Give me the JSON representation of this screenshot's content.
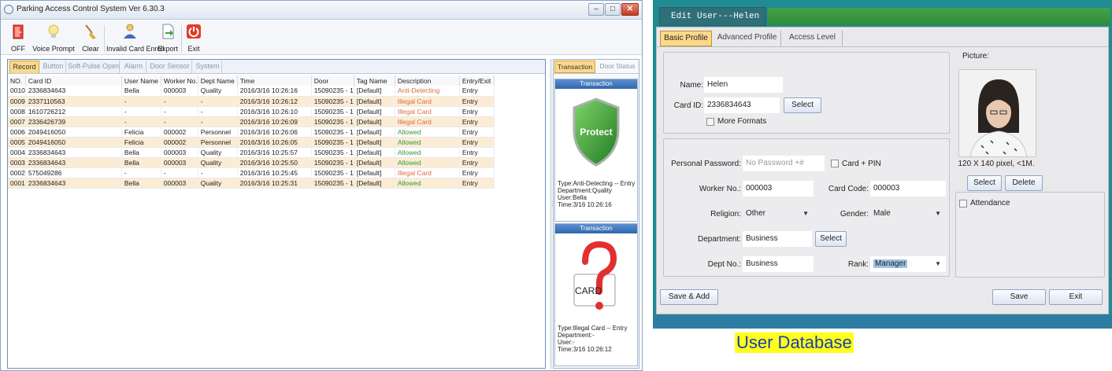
{
  "left_window": {
    "title": "Parking Access Control System  Ver 6.30.3",
    "controls": [
      "–",
      "□",
      "✕"
    ],
    "toolbar": [
      {
        "label": "OFF",
        "icon": "door-icon"
      },
      {
        "label": "Voice Prompt",
        "icon": "lightbulb-icon"
      },
      {
        "label": "Clear",
        "icon": "broom-icon"
      },
      {
        "label": "Invalid Card Enroll",
        "icon": "person-icon"
      },
      {
        "label": "Export",
        "icon": "export-icon"
      },
      {
        "label": "Exit",
        "icon": "power-icon"
      }
    ],
    "tabs": [
      "Record",
      "Button",
      "Soft-Pulse Open",
      "Alarm",
      "Door Sensor",
      "System"
    ],
    "active_tab": "Record",
    "table": {
      "columns": [
        "NO.",
        "Card ID",
        "User Name",
        "Worker No.",
        "Dept Name",
        "Time",
        "Door",
        "Tag Name",
        "Description",
        "Entry/Exit"
      ],
      "rows": [
        {
          "no": "0010",
          "card": "2336834643",
          "user": "Bella",
          "worker": "000003",
          "dept": "Quality",
          "time": "2016/3/16 10:26:16",
          "door": "15090235 - 1",
          "tag": "[Default]",
          "desc": "Anti-Detecting",
          "status": "red",
          "entry": "Entry"
        },
        {
          "no": "0009",
          "card": "2337110563",
          "user": "-",
          "worker": "-",
          "dept": "-",
          "time": "2016/3/16 10:26:12",
          "door": "15090235 - 1",
          "tag": "[Default]",
          "desc": "Illegal Card",
          "status": "red",
          "entry": "Entry"
        },
        {
          "no": "0008",
          "card": "1610726212",
          "user": "-",
          "worker": "-",
          "dept": "-",
          "time": "2016/3/16 10:26:10",
          "door": "15090235 - 1",
          "tag": "[Default]",
          "desc": "Illegal Card",
          "status": "red",
          "entry": "Entry"
        },
        {
          "no": "0007",
          "card": "2336426739",
          "user": "-",
          "worker": "-",
          "dept": "-",
          "time": "2016/3/16 10:26:09",
          "door": "15090235 - 1",
          "tag": "[Default]",
          "desc": "Illegal Card",
          "status": "red",
          "entry": "Entry"
        },
        {
          "no": "0006",
          "card": "2049416050",
          "user": "Felicia",
          "worker": "000002",
          "dept": "Personnel",
          "time": "2016/3/16 10:26:06",
          "door": "15090235 - 1",
          "tag": "[Default]",
          "desc": "Allowed",
          "status": "green",
          "entry": "Entry"
        },
        {
          "no": "0005",
          "card": "2049416050",
          "user": "Felicia",
          "worker": "000002",
          "dept": "Personnel",
          "time": "2016/3/16 10:26:05",
          "door": "15090235 - 1",
          "tag": "[Default]",
          "desc": "Allowed",
          "status": "green",
          "entry": "Entry"
        },
        {
          "no": "0004",
          "card": "2336834643",
          "user": "Bella",
          "worker": "000003",
          "dept": "Quality",
          "time": "2016/3/16 10:25:57",
          "door": "15090235 - 1",
          "tag": "[Default]",
          "desc": "Allowed",
          "status": "green",
          "entry": "Entry"
        },
        {
          "no": "0003",
          "card": "2336834643",
          "user": "Bella",
          "worker": "000003",
          "dept": "Quality",
          "time": "2016/3/16 10:25:50",
          "door": "15090235 - 1",
          "tag": "[Default]",
          "desc": "Allowed",
          "status": "green",
          "entry": "Entry"
        },
        {
          "no": "0002",
          "card": "575049286",
          "user": "-",
          "worker": "-",
          "dept": "-",
          "time": "2016/3/16 10:25:45",
          "door": "15090235 - 1",
          "tag": "[Default]",
          "desc": "Illegal Card",
          "status": "red",
          "entry": "Entry"
        },
        {
          "no": "0001",
          "card": "2336834643",
          "user": "Bella",
          "worker": "000003",
          "dept": "Quality",
          "time": "2016/3/16 10:25:31",
          "door": "15090235 - 1",
          "tag": "[Default]",
          "desc": "Allowed",
          "status": "green",
          "entry": "Entry"
        }
      ]
    },
    "right_tabs": [
      "Transaction",
      "Door Status"
    ],
    "cards": [
      {
        "header": "Transaction",
        "image": "shield-protect",
        "image_text": "Protect",
        "type": "Type:Anti-Detecting -- Entry",
        "department": "Department:Quality",
        "user": "User:Bella",
        "time": "Time:3/16 10:26:16"
      },
      {
        "header": "Transaction",
        "image": "question-card",
        "image_text": "CARD",
        "type": "Type:Illegal Card -- Entry",
        "department": "Department:-",
        "user": "User:-",
        "time": "Time:3/16 10:26:12"
      }
    ],
    "colors": {
      "status_red": "#e06b3c",
      "status_green": "#3a9a3a",
      "row_alt": "#fbecd3",
      "tab_active": "#fbd98b"
    }
  },
  "edit_window": {
    "title": "Edit User---Helen",
    "tabs": [
      "Basic Profile",
      "Advanced Profile",
      "Access Level"
    ],
    "active_tab": "Basic Profile",
    "name_label": "Name:",
    "name_value": "Helen",
    "card_id_label": "Card ID:",
    "card_id_value": "2336834643",
    "select_label": "Select",
    "more_formats_label": "More Formats",
    "picture_label": "Picture:",
    "picture_size": "120 X 140 pixel, <1M.",
    "picture_select": "Select",
    "picture_delete": "Delete",
    "attendance_label": "Attendance",
    "password_label": "Personal Password:",
    "password_placeholder": "No Password +#",
    "card_pin_label": "Card + PIN",
    "worker_label": "Worker No.:",
    "worker_value": "000003",
    "card_code_label": "Card Code:",
    "card_code_value": "000003",
    "religion_label": "Religion:",
    "religion_value": "Other",
    "gender_label": "Gender:",
    "gender_value": "Male",
    "department_label": "Department:",
    "department_value": "Business",
    "department_select": "Select",
    "dept_no_label": "Dept No.:",
    "dept_no_value": "Business",
    "rank_label": "Rank:",
    "rank_value": "Manager",
    "save_add_label": "Save & Add",
    "save_label": "Save",
    "exit_label": "Exit",
    "colors": {
      "frame": "#1f8b92",
      "stripe": "#2e8a38",
      "bottom_bar": "#2c7da1",
      "body": "#e9e9eb"
    }
  },
  "caption": "User Database",
  "caption_colors": {
    "background": "#ffff1a",
    "text": "#1a3db0"
  }
}
